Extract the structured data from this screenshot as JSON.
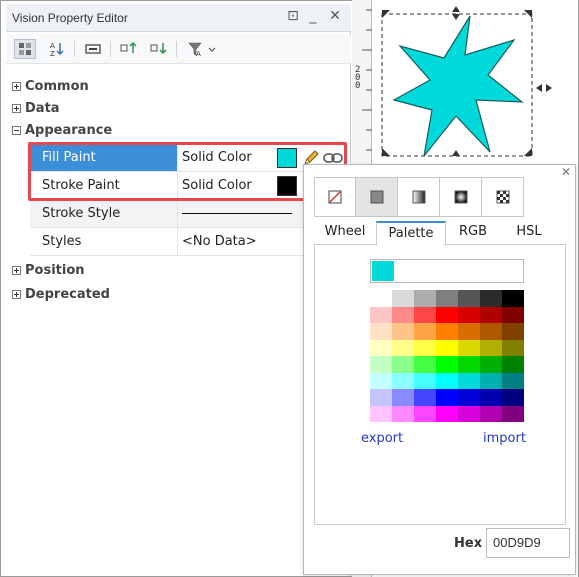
{
  "editor": {
    "title": "Vision Property Editor",
    "window_buttons": [
      "⊡",
      "_",
      "✕"
    ]
  },
  "tree": {
    "categories": [
      {
        "label": "Common",
        "expanded": false
      },
      {
        "label": "Data",
        "expanded": false
      },
      {
        "label": "Appearance",
        "expanded": true
      },
      {
        "label": "Position",
        "expanded": false
      },
      {
        "label": "Deprecated",
        "expanded": false
      }
    ],
    "properties": [
      {
        "name": "Fill Paint",
        "value": "Solid Color",
        "color": "#00D9D9",
        "selected": true
      },
      {
        "name": "Stroke Paint",
        "value": "Solid Color",
        "color": "#000000",
        "selected": false
      },
      {
        "name": "Stroke Style",
        "value": "",
        "selected": false
      },
      {
        "name": "Styles",
        "value": "<No Data>",
        "selected": false
      }
    ]
  },
  "ruler": {
    "label": "2\n0\n0"
  },
  "color_popup": {
    "tabs": [
      "Wheel",
      "Palette",
      "RGB",
      "HSL"
    ],
    "active_tab": "Palette",
    "current_color": "#00D9D9",
    "export_label": "export",
    "import_label": "import",
    "hex_label": "Hex",
    "hex_value": "00D9D9",
    "palette": [
      [
        "#ffffff",
        "#d9d9d9",
        "#adadad",
        "#7f7f7f",
        "#555555",
        "#2b2b2b",
        "#000000"
      ],
      [
        "#ffc4c4",
        "#ff8a8a",
        "#ff4545",
        "#ff0000",
        "#d90000",
        "#b00000",
        "#800000"
      ],
      [
        "#ffe0c4",
        "#ffc48a",
        "#ffa545",
        "#ff8000",
        "#d96d00",
        "#b05800",
        "#804000"
      ],
      [
        "#ffffc4",
        "#ffff8a",
        "#ffff45",
        "#ffff00",
        "#d9d900",
        "#b0b000",
        "#808000"
      ],
      [
        "#c4ffc4",
        "#8aff8a",
        "#45ff45",
        "#00ff00",
        "#00d900",
        "#00b000",
        "#008000"
      ],
      [
        "#c4ffff",
        "#8affff",
        "#45ffff",
        "#00ffff",
        "#00d9d9",
        "#00b0b0",
        "#008080"
      ],
      [
        "#c4c4ff",
        "#8a8aff",
        "#4545ff",
        "#0000ff",
        "#0000d9",
        "#0000b0",
        "#000080"
      ],
      [
        "#ffc4ff",
        "#ff8aff",
        "#ff45ff",
        "#ff00ff",
        "#d900d9",
        "#b000b0",
        "#800080"
      ]
    ]
  },
  "colors": {
    "selection": "#3b8fd9",
    "highlight": "#e5484d",
    "star_fill": "#00D9D9"
  }
}
